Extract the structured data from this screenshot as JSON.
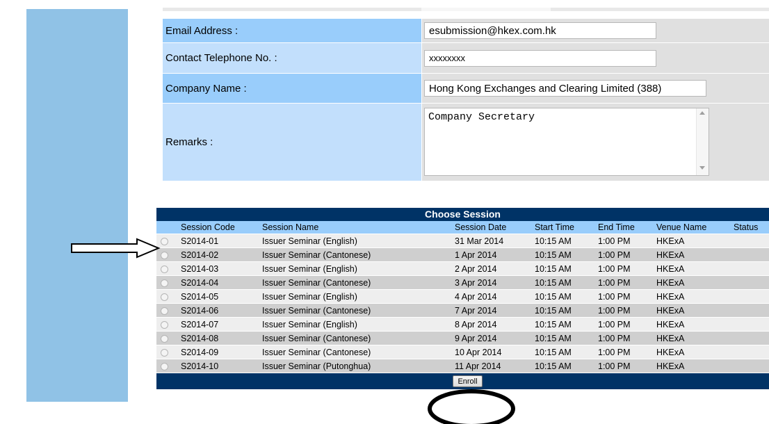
{
  "form": {
    "email": {
      "label": "Email Address :",
      "value": "esubmission@hkex.com.hk"
    },
    "phone": {
      "label": "Contact Telephone No. :",
      "value": "xxxxxxxx"
    },
    "company": {
      "label": "Company Name :",
      "value": "Hong Kong Exchanges and Clearing Limited (388)"
    },
    "remarks": {
      "label": "Remarks :",
      "value": "Company Secretary"
    }
  },
  "sessions": {
    "title": "Choose Session",
    "columns": [
      "",
      "Session Code",
      "Session Name",
      "Session Date",
      "Start Time",
      "End Time",
      "Venue Name",
      "Status"
    ],
    "rows": [
      [
        "S2014-01",
        "Issuer Seminar (English)",
        "31 Mar 2014",
        "10:15 AM",
        "1:00 PM",
        "HKExA",
        ""
      ],
      [
        "S2014-02",
        "Issuer Seminar (Cantonese)",
        "1 Apr 2014",
        "10:15 AM",
        "1:00 PM",
        "HKExA",
        ""
      ],
      [
        "S2014-03",
        "Issuer Seminar (English)",
        "2 Apr 2014",
        "10:15 AM",
        "1:00 PM",
        "HKExA",
        ""
      ],
      [
        "S2014-04",
        "Issuer Seminar (Cantonese)",
        "3 Apr 2014",
        "10:15 AM",
        "1:00 PM",
        "HKExA",
        ""
      ],
      [
        "S2014-05",
        "Issuer Seminar (English)",
        "4 Apr 2014",
        "10:15 AM",
        "1:00 PM",
        "HKExA",
        ""
      ],
      [
        "S2014-06",
        "Issuer Seminar (Cantonese)",
        "7 Apr 2014",
        "10:15 AM",
        "1:00 PM",
        "HKExA",
        ""
      ],
      [
        "S2014-07",
        "Issuer Seminar (English)",
        "8 Apr 2014",
        "10:15 AM",
        "1:00 PM",
        "HKExA",
        ""
      ],
      [
        "S2014-08",
        "Issuer Seminar (Cantonese)",
        "9 Apr 2014",
        "10:15 AM",
        "1:00 PM",
        "HKExA",
        ""
      ],
      [
        "S2014-09",
        "Issuer Seminar (Cantonese)",
        "10 Apr 2014",
        "10:15 AM",
        "1:00 PM",
        "HKExA",
        ""
      ],
      [
        "S2014-10",
        "Issuer Seminar (Putonghua)",
        "11 Apr 2014",
        "10:15 AM",
        "1:00 PM",
        "HKExA",
        ""
      ]
    ],
    "enroll_label": "Enroll"
  },
  "annotations": {
    "arrow": "arrow-right-icon",
    "highlight": "ellipse-highlight"
  },
  "colors": {
    "header_navy": "#003366",
    "label_blue": "#99cdfb",
    "label_light_blue": "#c2dffc",
    "sidebar": "#90c2e6",
    "annotation": "#000000"
  }
}
